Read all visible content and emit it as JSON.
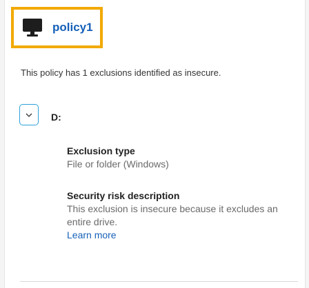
{
  "policy": {
    "name": "policy1",
    "icon": "monitor-icon",
    "highlight_color": "#f2a900"
  },
  "summary": "This policy has 1 exclusions identified as insecure.",
  "exclusion": {
    "path": "D:",
    "expander_icon": "chevron-down-icon",
    "type_title": "Exclusion type",
    "type_value": "File or folder (Windows)",
    "risk_title": "Security risk description",
    "risk_value": "This exclusion is insecure because it excludes an entire drive.",
    "learn_more": "Learn more"
  }
}
